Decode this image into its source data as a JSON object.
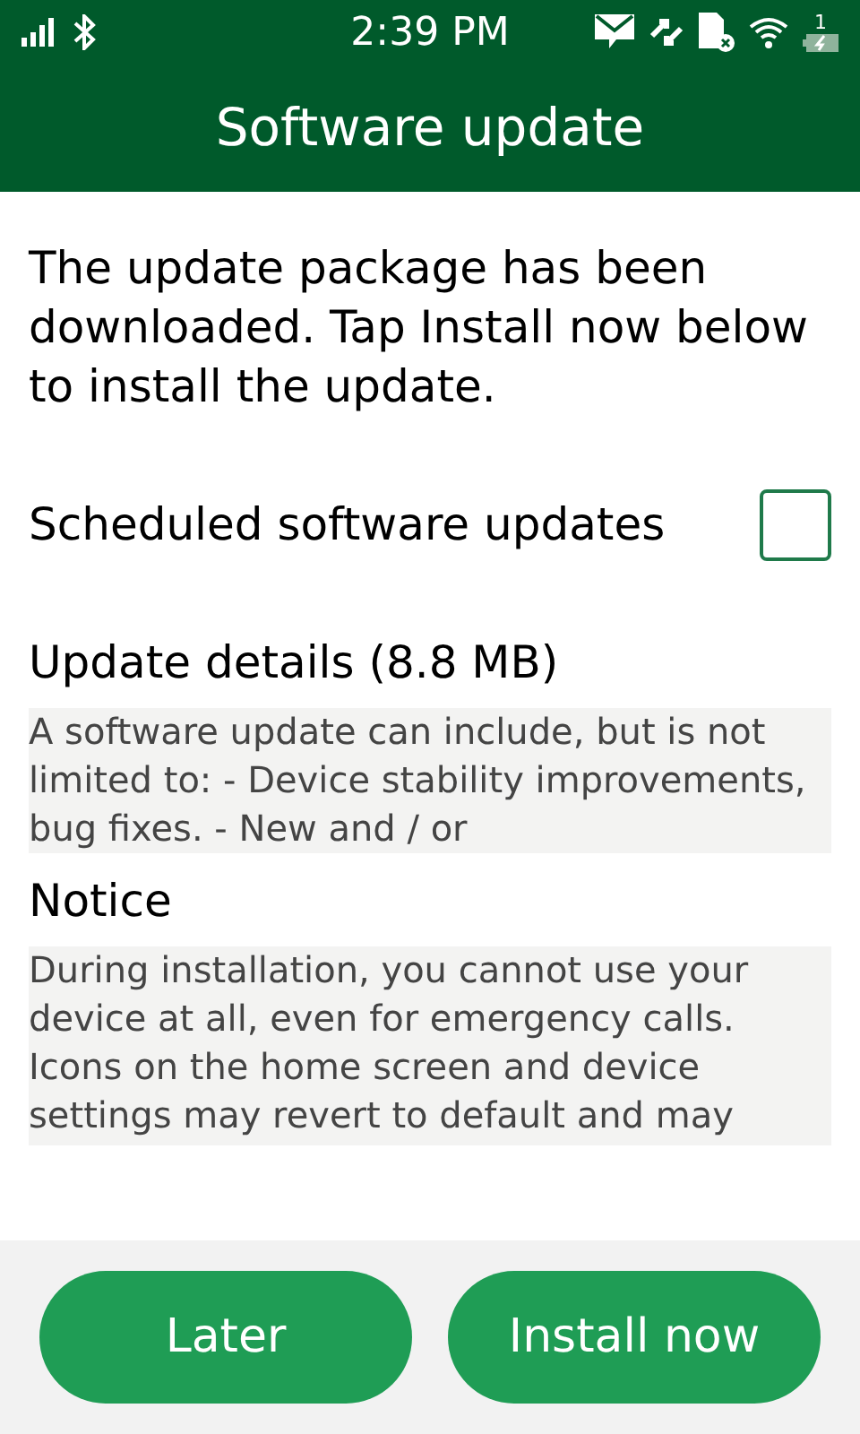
{
  "status_bar": {
    "time": "2:39 PM",
    "battery_badge": "1"
  },
  "header": {
    "title": "Software update"
  },
  "message": "The update package has been downloaded. Tap Install now below to install the update.",
  "scheduled": {
    "label": "Scheduled software updates",
    "checked": false
  },
  "sections": [
    {
      "heading": "Update details (8.8 MB)",
      "body": "A software update can include, but is not limited to: - Device stability improvements, bug fixes. - New and / or"
    },
    {
      "heading": "Notice",
      "body": "During installation, you cannot use your device at all, even for emergency calls. Icons on the home screen and device settings may revert to default and may"
    }
  ],
  "buttons": [
    "Later",
    "Install now"
  ]
}
